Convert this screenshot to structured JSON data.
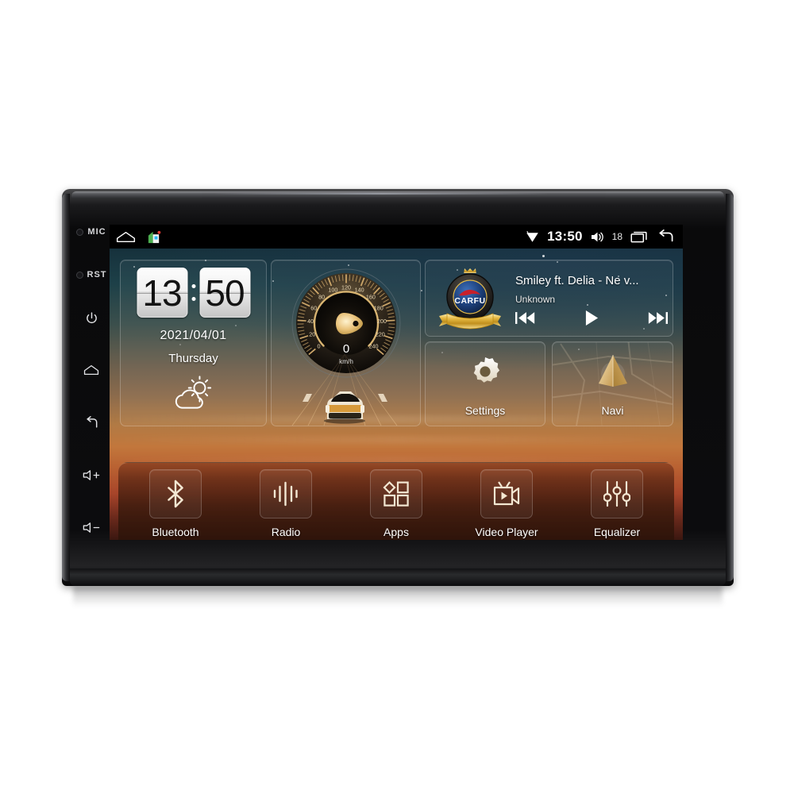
{
  "device": {
    "bezel_buttons": [
      {
        "name": "mic",
        "label": "MIC",
        "type": "pinhole"
      },
      {
        "name": "reset",
        "label": "RST",
        "type": "pinhole"
      },
      {
        "name": "power",
        "label": "",
        "icon": "power-icon"
      },
      {
        "name": "home",
        "label": "",
        "icon": "home-icon"
      },
      {
        "name": "back",
        "label": "",
        "icon": "back-icon"
      },
      {
        "name": "volume-up",
        "label": "+",
        "icon": "speaker-plus-icon"
      },
      {
        "name": "volume-down",
        "label": "-",
        "icon": "speaker-minus-icon"
      }
    ]
  },
  "statusbar": {
    "home_icon": "home-outline-icon",
    "launcher_icon": "house-app-icon",
    "wifi_icon": "wifi-icon",
    "time": "13:50",
    "volume_icon": "volume-icon",
    "volume_level": "18",
    "recents_icon": "recents-icon",
    "back_icon": "back-arrow-icon"
  },
  "clock_widget": {
    "hours": "13",
    "minutes": "50",
    "date": "2021/04/01",
    "weekday": "Thursday",
    "weather_icon": "partly-cloudy-icon"
  },
  "speed_widget": {
    "value": "0",
    "unit": "km/h",
    "ticks": [
      "0",
      "20",
      "40",
      "60",
      "80",
      "100",
      "120",
      "140",
      "160",
      "180",
      "200",
      "220",
      "240"
    ],
    "min": 0,
    "max": 240,
    "needle_icon": "speed-pointer-icon",
    "road_icon": "car-on-road-icon",
    "accent": "#e9c27a"
  },
  "music_widget": {
    "logo_text": "CARFU",
    "logo_name": "carfu-badge-logo",
    "title": "Smiley ft. Delia - Ne v...",
    "artist": "Unknown",
    "controls": [
      {
        "name": "previous-button",
        "icon": "skip-previous-icon"
      },
      {
        "name": "play-button",
        "icon": "play-icon"
      },
      {
        "name": "next-button",
        "icon": "skip-next-icon"
      }
    ]
  },
  "tiles": [
    {
      "name": "settings",
      "label": "Settings",
      "icon": "gear-icon"
    },
    {
      "name": "navi",
      "label": "Navi",
      "icon": "navigation-arrow-icon"
    }
  ],
  "dock": [
    {
      "name": "bluetooth",
      "label": "Bluetooth",
      "icon": "bluetooth-icon"
    },
    {
      "name": "radio",
      "label": "Radio",
      "icon": "radio-waves-icon"
    },
    {
      "name": "apps",
      "label": "Apps",
      "icon": "apps-grid-icon"
    },
    {
      "name": "video-player",
      "label": "Video Player",
      "icon": "video-camera-icon"
    },
    {
      "name": "equalizer",
      "label": "Equalizer",
      "icon": "equalizer-sliders-icon"
    }
  ],
  "colors": {
    "accent_gold": "#e9c27a",
    "sky_top": "#16313c",
    "sunset_mid": "#c2773c",
    "sunset_bottom": "#3a1710",
    "logo_blue": "#1c3f7a",
    "logo_red": "#c8202b"
  }
}
